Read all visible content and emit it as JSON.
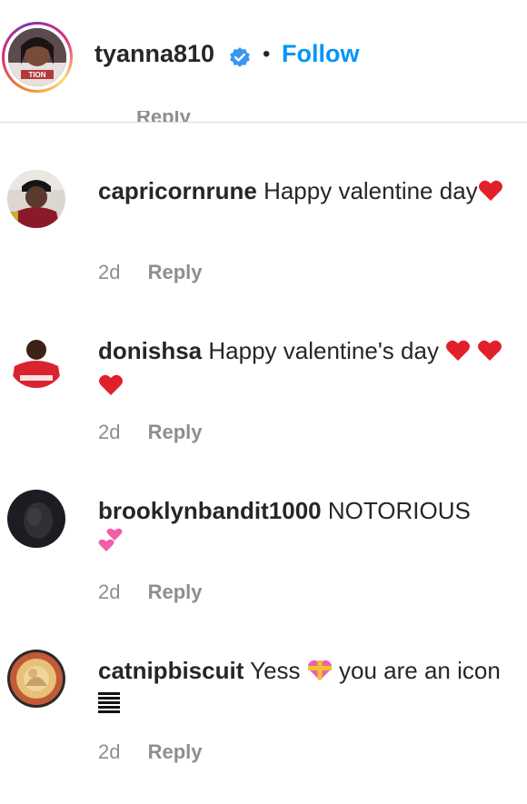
{
  "header": {
    "username": "tyanna810",
    "separator": "•",
    "follow_label": "Follow",
    "partial_reply_text": "Reply"
  },
  "comments": [
    {
      "username": "capricornrune",
      "text": "Happy valentine day",
      "emoji": [
        "red-heart"
      ],
      "time": "2d",
      "reply_label": "Reply"
    },
    {
      "username": "donishsa",
      "text": "Happy valentine's day",
      "emoji": [
        "red-heart",
        "red-heart",
        "red-heart"
      ],
      "time": "2d",
      "reply_label": "Reply"
    },
    {
      "username": "brooklynbandit1000",
      "text": "NOTORIOUS",
      "emoji": [
        "two-hearts"
      ],
      "time": "2d",
      "reply_label": "Reply"
    },
    {
      "username": "catnipbiscuit",
      "text_before_emoji": "Yess",
      "text_after_emoji": "you are an icon",
      "emoji": [
        "heart-with-ribbon",
        "bars"
      ],
      "time": "2d",
      "reply_label": "Reply"
    }
  ],
  "colors": {
    "text": "#262626",
    "secondary": "#8e8e8e",
    "link": "#0095f6",
    "verified": "#3897f0",
    "heart": "#e0202a",
    "divider": "#dbdbdb"
  }
}
